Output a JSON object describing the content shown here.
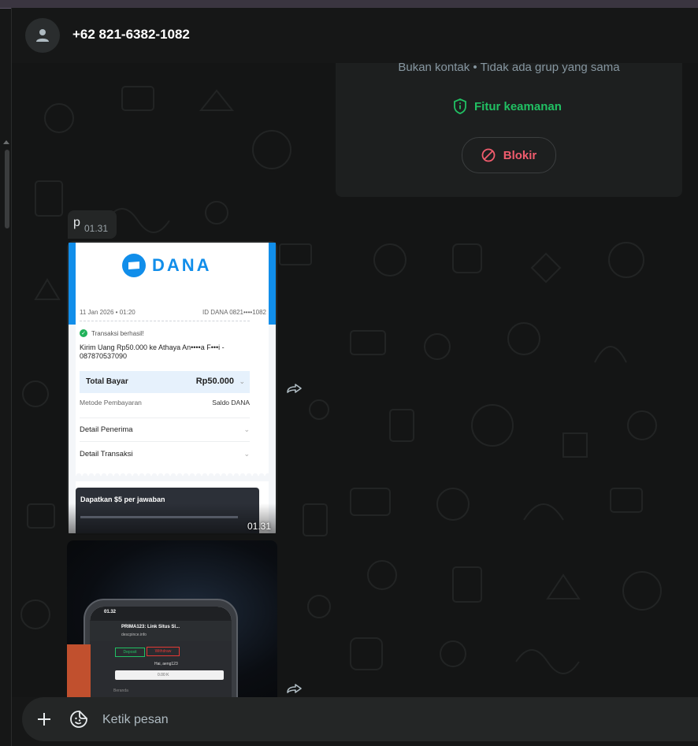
{
  "contact": {
    "name": "+62 821-6382-1082"
  },
  "info_card": {
    "subtitle": "Bukan kontak • Tidak ada grup yang sama",
    "security_label": "Fitur keamanan",
    "block_label": "Blokir"
  },
  "messages": [
    {
      "text": "p",
      "time": "01.31"
    },
    {
      "time": "01.31",
      "receipt": {
        "brand": "DANA",
        "date": "11 Jan 2026 • 01:20",
        "id": "ID DANA 0821••••1082",
        "status": "Transaksi berhasil!",
        "description": "Kirim Uang Rp50.000 ke Athaya An••••a F•••i - 087870537090",
        "total_label": "Total Bayar",
        "total_value": "Rp50.000",
        "method_label": "Metode Pembayaran",
        "method_value": "Saldo DANA",
        "recipient_label": "Detail Penerima",
        "transaction_label": "Detail Transaksi",
        "ad_title": "Dapatkan $5 per jawaban"
      }
    },
    {
      "photo": {
        "status_time": "01.32",
        "site_title": "PRIMA123: Link Situs Sl...",
        "site_url": "descpince.info",
        "deposit": "Deposit",
        "withdraw": "Withdraw",
        "user": "Hai, aeng123",
        "balance": "0.00 K",
        "home": "Beranda"
      }
    }
  ],
  "composer": {
    "placeholder": "Ketik pesan"
  },
  "colors": {
    "accent": "#21c063",
    "danger": "#f15c6d",
    "dana_blue": "#118eea"
  },
  "icons": [
    "person-icon",
    "shield-icon",
    "block-icon",
    "forward-icon",
    "plus-icon",
    "sticker-icon",
    "chevron-down-icon",
    "check-icon"
  ]
}
